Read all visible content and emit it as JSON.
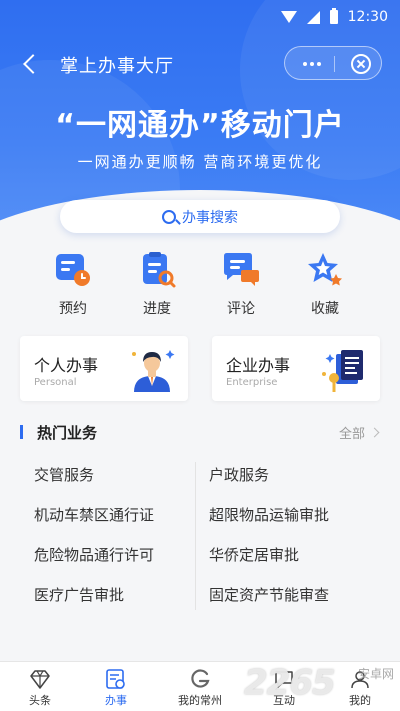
{
  "status_bar": {
    "time": "12:30"
  },
  "nav": {
    "title": "掌上办事大厅"
  },
  "hero": {
    "title": "“一网通办”移动门户",
    "subtitle": "一网通办更顺畅 营商环境更优化"
  },
  "search": {
    "label": "办事搜索"
  },
  "quick_actions": [
    {
      "label": "预约",
      "icon": "appointment-icon"
    },
    {
      "label": "进度",
      "icon": "progress-icon"
    },
    {
      "label": "评论",
      "icon": "comment-icon"
    },
    {
      "label": "收藏",
      "icon": "favorite-icon"
    }
  ],
  "business_cards": [
    {
      "name": "个人办事",
      "en": "Personal",
      "icon": "person-icon"
    },
    {
      "name": "企业办事",
      "en": "Enterprise",
      "icon": "enterprise-icon"
    }
  ],
  "hot": {
    "title": "热门业务",
    "all_label": "全部",
    "items": [
      "交管服务",
      "户政服务",
      "机动车禁区通行证",
      "超限物品运输审批",
      "危险物品通行许可",
      "华侨定居审批",
      "医疗广告审批",
      "固定资产节能审查"
    ]
  },
  "tabs": [
    {
      "label": "头条",
      "icon": "diamond-icon",
      "active": false
    },
    {
      "label": "办事",
      "icon": "service-icon",
      "active": true
    },
    {
      "label": "我的常州",
      "icon": "city-icon",
      "active": false
    },
    {
      "label": "互动",
      "icon": "interact-icon",
      "active": false
    },
    {
      "label": "我的",
      "icon": "user-icon",
      "active": false
    }
  ],
  "watermark": {
    "number": "2265",
    "text": "安卓网"
  },
  "colors": {
    "primary": "#2d6cf0",
    "accent_orange": "#f07a2a"
  }
}
